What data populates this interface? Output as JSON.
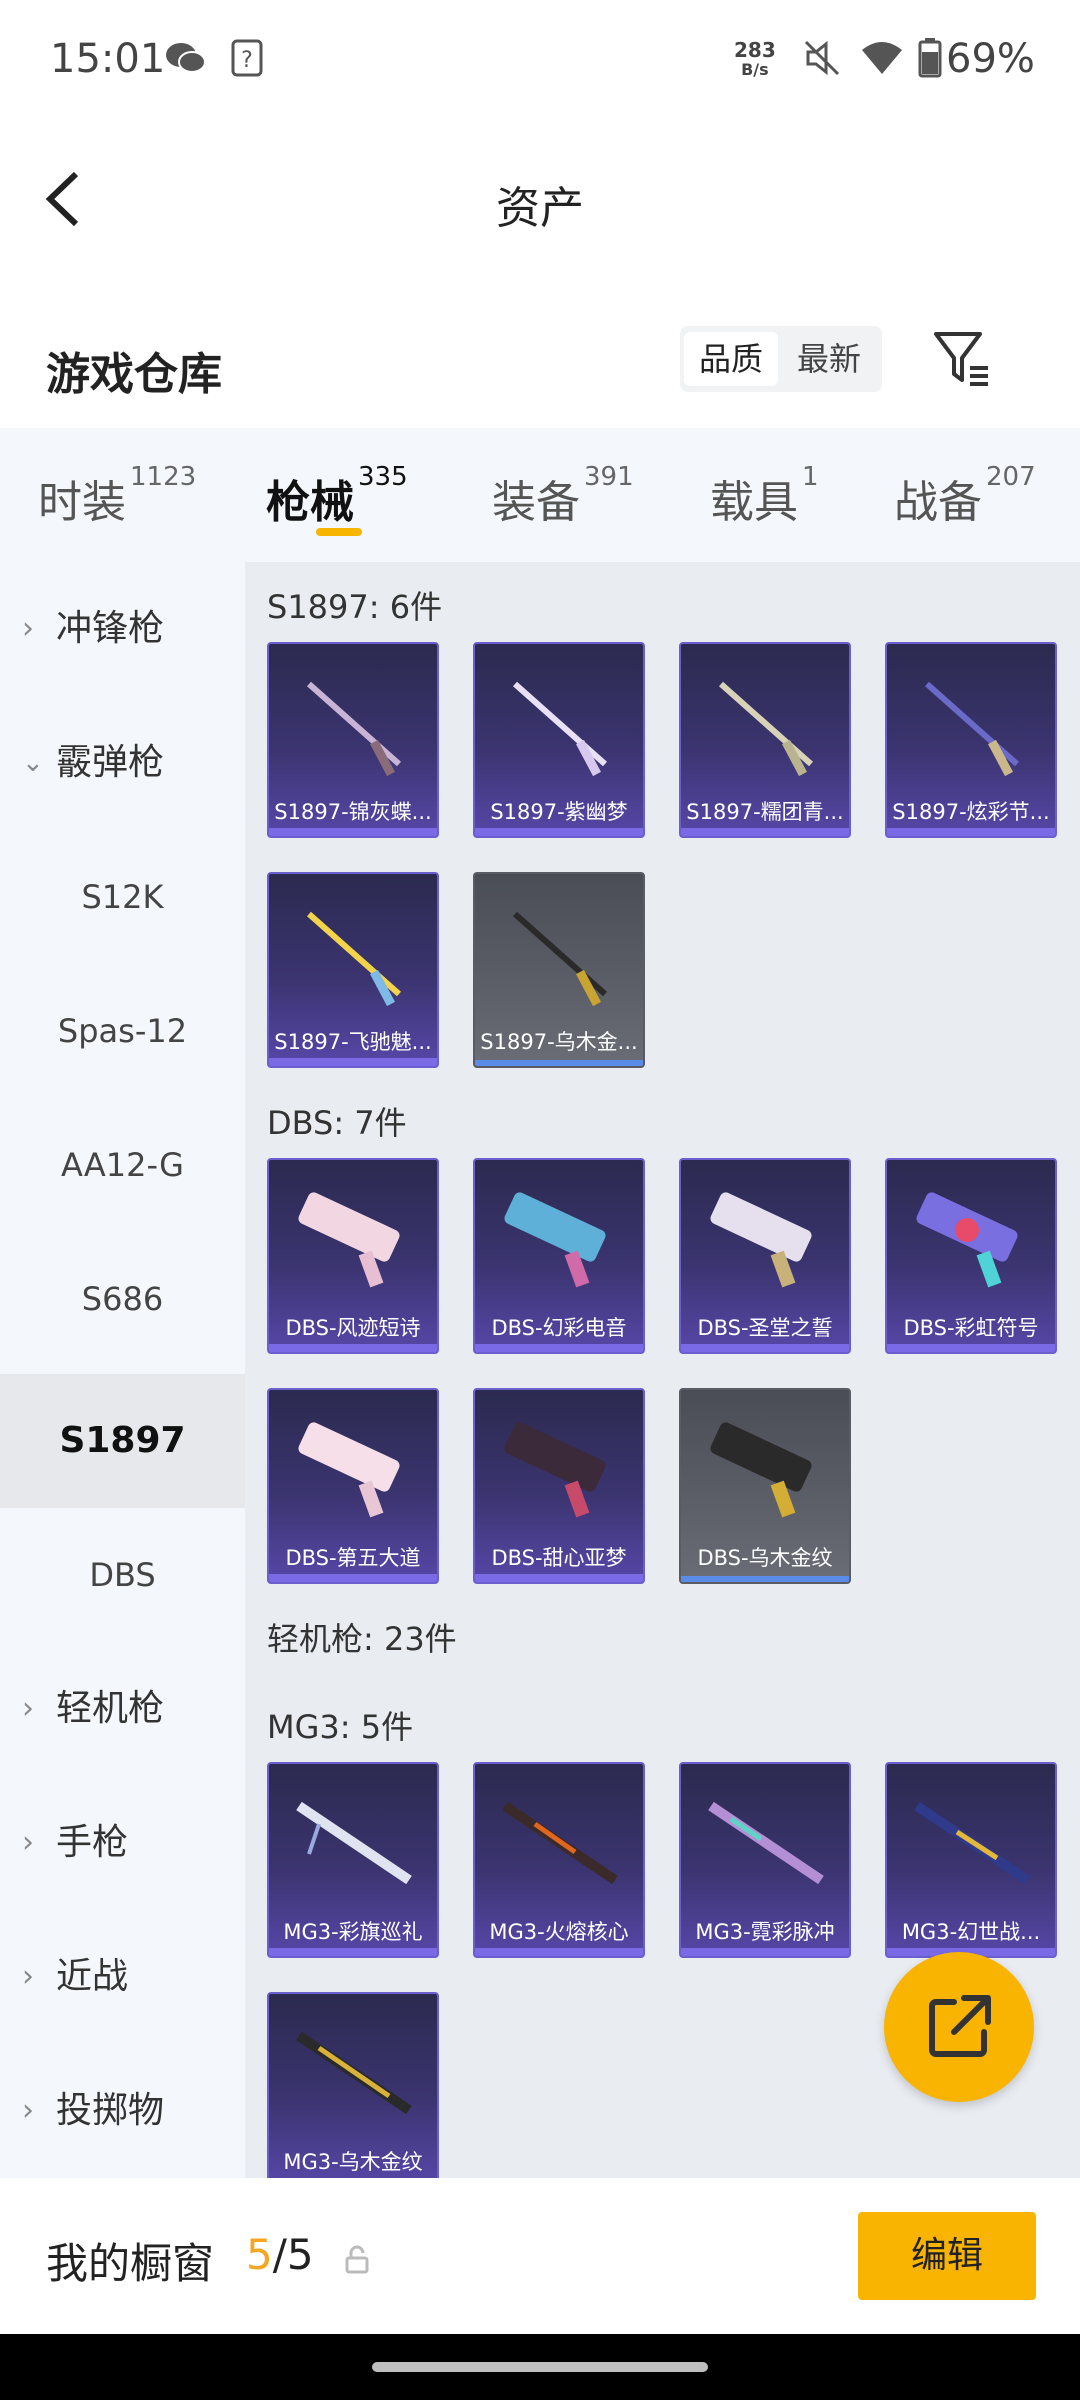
{
  "status_bar": {
    "time": "15:01",
    "net_speed_value": "283",
    "net_speed_unit": "B/s",
    "battery": "69%",
    "icons": [
      "wechat-icon",
      "unknown-app-icon",
      "mute-icon",
      "wifi-icon",
      "battery-icon"
    ]
  },
  "header": {
    "title": "资产"
  },
  "section": {
    "title": "游戏仓库",
    "sort": {
      "quality": "品质",
      "latest": "最新"
    }
  },
  "tabs": [
    {
      "label": "时装",
      "count": "1123"
    },
    {
      "label": "枪械",
      "count": "335"
    },
    {
      "label": "装备",
      "count": "391"
    },
    {
      "label": "载具",
      "count": "1"
    },
    {
      "label": "战备",
      "count": "207"
    }
  ],
  "sidebar": {
    "smg": "冲锋枪",
    "shotgun": "霰弹枪",
    "sub": [
      "S12K",
      "Spas-12",
      "AA12-G",
      "S686",
      "S1897",
      "DBS"
    ],
    "lmg": "轻机枪",
    "pistol": "手枪",
    "melee": "近战",
    "throwable": "投掷物"
  },
  "content": {
    "s1897_label": "S1897: 6件",
    "s1897_items": [
      "S1897-锦灰蝶...",
      "S1897-紫幽梦",
      "S1897-糯团青...",
      "S1897-炫彩节...",
      "S1897-飞驰魅...",
      "S1897-乌木金..."
    ],
    "dbs_label": "DBS: 7件",
    "dbs_items": [
      "DBS-风迹短诗",
      "DBS-幻彩电音",
      "DBS-圣堂之誓",
      "DBS-彩虹符号",
      "DBS-第五大道",
      "DBS-甜心亚梦",
      "DBS-乌木金纹"
    ],
    "lmg_label": "轻机枪: 23件",
    "mg3_label": "MG3: 5件",
    "mg3_items": [
      "MG3-彩旗巡礼",
      "MG3-火熔核心",
      "MG3-霓彩脉冲",
      "MG3-幻世战...",
      "MG3-乌木金纹"
    ]
  },
  "bottom": {
    "label": "我的橱窗",
    "count_current": "5",
    "count_total": "/5",
    "edit": "编辑"
  },
  "colors": {
    "accent": "#f8b400",
    "card_purple": "#3b3470",
    "card_grey": "#5c5f68"
  }
}
